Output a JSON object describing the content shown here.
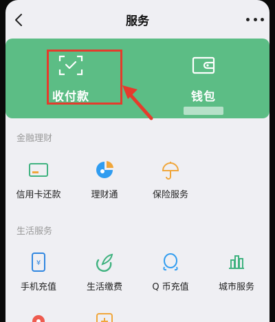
{
  "nav": {
    "title": "服务"
  },
  "top_card": {
    "pay_label": "收付款",
    "wallet_label": "钱包",
    "bg": "#5cbd85"
  },
  "finance": {
    "title": "金融理财",
    "items": [
      {
        "label": "信用卡还款",
        "icon": "credit-card-icon"
      },
      {
        "label": "理财通",
        "icon": "wealth-icon"
      },
      {
        "label": "保险服务",
        "icon": "insurance-icon"
      }
    ]
  },
  "life": {
    "title": "生活服务",
    "items": [
      {
        "label": "手机充值",
        "icon": "mobile-topup-icon"
      },
      {
        "label": "生活缴费",
        "icon": "utility-payment-icon"
      },
      {
        "label": "Q 币充值",
        "icon": "q-coin-icon"
      },
      {
        "label": "城市服务",
        "icon": "city-service-icon"
      }
    ]
  },
  "colors": {
    "accent_green": "#5cbd85",
    "highlight_red": "#e53b2c"
  }
}
